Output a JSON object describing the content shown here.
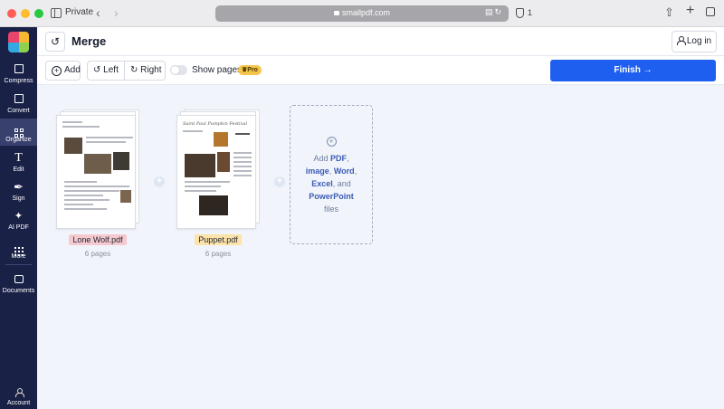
{
  "browser": {
    "mode_label": "Private",
    "url": "smallpdf.com",
    "tracker_count": "1"
  },
  "sidebar": {
    "items": [
      {
        "label": "Compress",
        "icon": "compress-icon"
      },
      {
        "label": "Convert",
        "icon": "convert-icon"
      },
      {
        "label": "Organize",
        "icon": "organize-icon",
        "active": true
      },
      {
        "label": "Edit",
        "icon": "edit-icon"
      },
      {
        "label": "Sign",
        "icon": "sign-icon"
      },
      {
        "label": "AI PDF",
        "icon": "ai-sparkle-icon"
      },
      {
        "label": "More",
        "icon": "more-grid-icon"
      },
      {
        "label": "Documents",
        "icon": "folder-icon"
      }
    ],
    "account_label": "Account"
  },
  "header": {
    "title": "Merge",
    "login_label": "Log in"
  },
  "toolbar": {
    "add_label": "Add",
    "rotate_left_label": "Left",
    "rotate_right_label": "Right",
    "show_pages_label": "Show pages",
    "pro_badge": "Pro",
    "finish_label": "Finish"
  },
  "files": [
    {
      "name": "Lone Wolf.pdf",
      "pages": "6 pages",
      "tag_color": "#f5c9cf"
    },
    {
      "name": "Puppet.pdf",
      "pages": "6 pages",
      "tag_color": "#fbe3a9",
      "title_script": "Saint Paul Pumpkin Festival"
    }
  ],
  "dropzone": {
    "w1": "Add",
    "pdf": "PDF",
    "comma1": ",",
    "image": "image",
    "comma2": ",",
    "word": "Word",
    "comma3": ",",
    "excel": "Excel",
    "and": ", and",
    "powerpoint": "PowerPoint",
    "files": "files"
  },
  "colors": {
    "sidebar_bg": "#1a2147",
    "accent": "#1f5ff0",
    "workspace_bg": "#f1f5fb"
  }
}
